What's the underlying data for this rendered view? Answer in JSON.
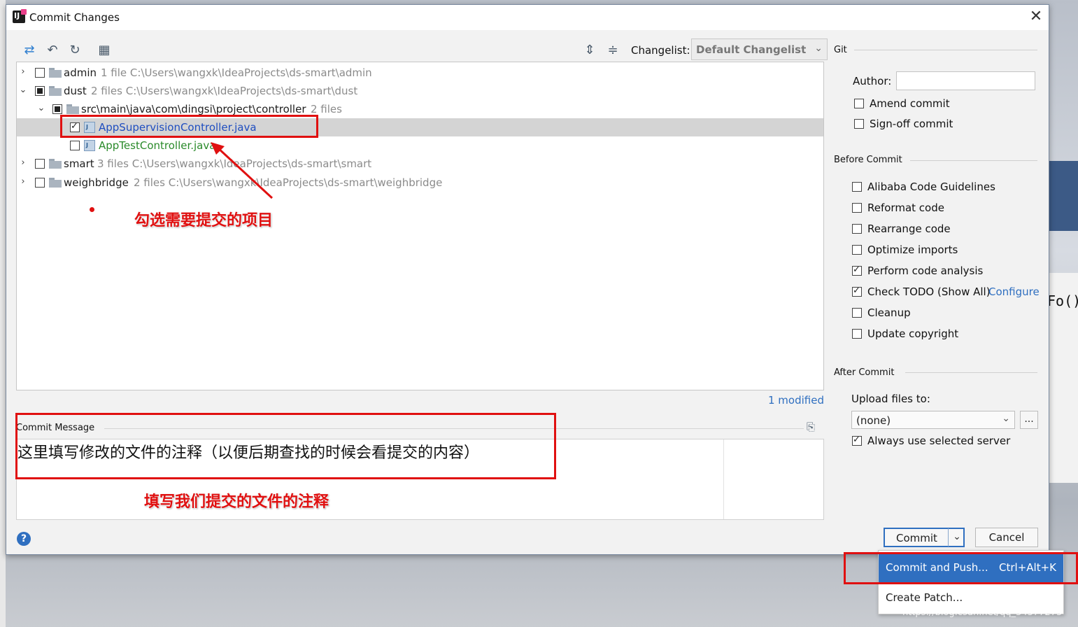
{
  "dialog": {
    "title": "Commit Changes",
    "close": "✕"
  },
  "toolbar": {
    "icons": [
      "refresh-arrow-icon",
      "rollback-icon",
      "refresh-icon",
      "group-by-icon",
      "expand-all-icon",
      "collapse-all-icon"
    ],
    "changelist_label": "Changelist:",
    "changelist_value": "Default Changelist"
  },
  "tree": {
    "rows": [
      {
        "name": "admin",
        "info": "1 file  C:\\Users\\wangxk\\IdeaProjects\\ds-smart\\admin"
      },
      {
        "name": "dust",
        "info": "2 files  C:\\Users\\wangxk\\IdeaProjects\\ds-smart\\dust"
      },
      {
        "name": "src\\main\\java\\com\\dingsi\\project\\controller",
        "info": "2 files"
      },
      {
        "name": "AppSupervisionController.java",
        "info": ""
      },
      {
        "name": "AppTestController.java",
        "info": ""
      },
      {
        "name": "smart",
        "info": "3 files  C:\\Users\\wangxk\\IdeaProjects\\ds-smart\\smart"
      },
      {
        "name": "weighbridge",
        "info": "2 files  C:\\Users\\wangxk\\IdeaProjects\\ds-smart\\weighbridge"
      }
    ],
    "modified": "1 modified"
  },
  "annotations": {
    "select_note": "勾选需要提交的项目",
    "message_note": "填写我们提交的文件的注释"
  },
  "commit_message": {
    "label": "Commit Message",
    "text": "这里填写修改的文件的注释（以便后期查找的时候会看提交的内容）"
  },
  "git": {
    "title": "Git",
    "author_label": "Author:",
    "author_value": "",
    "amend": "Amend commit",
    "signoff": "Sign-off commit"
  },
  "before_commit": {
    "title": "Before Commit",
    "options": [
      {
        "label": "Alibaba Code Guidelines",
        "checked": false
      },
      {
        "label": "Reformat code",
        "checked": false
      },
      {
        "label": "Rearrange code",
        "checked": false
      },
      {
        "label": "Optimize imports",
        "checked": false
      },
      {
        "label": "Perform code analysis",
        "checked": true
      },
      {
        "label": "Check TODO (Show All)",
        "checked": true
      },
      {
        "label": "Cleanup",
        "checked": false
      },
      {
        "label": "Update copyright",
        "checked": false
      }
    ],
    "configure_link": "Configure"
  },
  "after_commit": {
    "title": "After Commit",
    "upload_label": "Upload files to:",
    "upload_value": "(none)",
    "browse": "...",
    "always_use": "Always use selected server"
  },
  "buttons": {
    "help": "?",
    "commit": "Commit",
    "cancel": "Cancel"
  },
  "menu": {
    "commit_push": "Commit and Push...",
    "commit_push_shortcut": "Ctrl+Alt+K",
    "create_patch": "Create Patch..."
  },
  "background": {
    "code_fragment": "Fo()"
  },
  "watermark": "https://blog.csdn.net/qq_34377273",
  "colors": {
    "accent": "#2f6fc0",
    "annotation_red": "#e01010",
    "unversioned_green": "#2a8a2a",
    "modified_blue": "#1f4ec0"
  }
}
